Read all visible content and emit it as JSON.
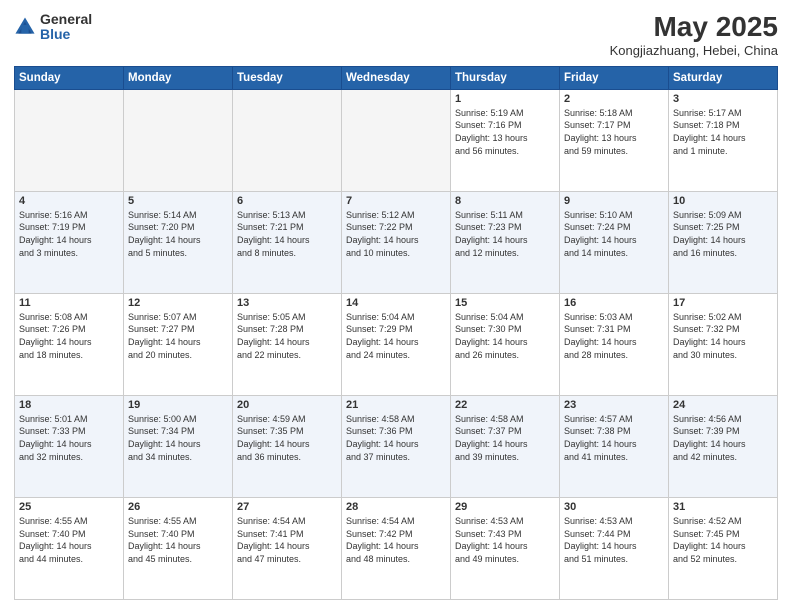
{
  "header": {
    "logo_line1": "General",
    "logo_line2": "Blue",
    "month_title": "May 2025",
    "location": "Kongjiazhuang, Hebei, China"
  },
  "weekdays": [
    "Sunday",
    "Monday",
    "Tuesday",
    "Wednesday",
    "Thursday",
    "Friday",
    "Saturday"
  ],
  "weeks": [
    [
      {
        "day": "",
        "info": ""
      },
      {
        "day": "",
        "info": ""
      },
      {
        "day": "",
        "info": ""
      },
      {
        "day": "",
        "info": ""
      },
      {
        "day": "1",
        "info": "Sunrise: 5:19 AM\nSunset: 7:16 PM\nDaylight: 13 hours\nand 56 minutes."
      },
      {
        "day": "2",
        "info": "Sunrise: 5:18 AM\nSunset: 7:17 PM\nDaylight: 13 hours\nand 59 minutes."
      },
      {
        "day": "3",
        "info": "Sunrise: 5:17 AM\nSunset: 7:18 PM\nDaylight: 14 hours\nand 1 minute."
      }
    ],
    [
      {
        "day": "4",
        "info": "Sunrise: 5:16 AM\nSunset: 7:19 PM\nDaylight: 14 hours\nand 3 minutes."
      },
      {
        "day": "5",
        "info": "Sunrise: 5:14 AM\nSunset: 7:20 PM\nDaylight: 14 hours\nand 5 minutes."
      },
      {
        "day": "6",
        "info": "Sunrise: 5:13 AM\nSunset: 7:21 PM\nDaylight: 14 hours\nand 8 minutes."
      },
      {
        "day": "7",
        "info": "Sunrise: 5:12 AM\nSunset: 7:22 PM\nDaylight: 14 hours\nand 10 minutes."
      },
      {
        "day": "8",
        "info": "Sunrise: 5:11 AM\nSunset: 7:23 PM\nDaylight: 14 hours\nand 12 minutes."
      },
      {
        "day": "9",
        "info": "Sunrise: 5:10 AM\nSunset: 7:24 PM\nDaylight: 14 hours\nand 14 minutes."
      },
      {
        "day": "10",
        "info": "Sunrise: 5:09 AM\nSunset: 7:25 PM\nDaylight: 14 hours\nand 16 minutes."
      }
    ],
    [
      {
        "day": "11",
        "info": "Sunrise: 5:08 AM\nSunset: 7:26 PM\nDaylight: 14 hours\nand 18 minutes."
      },
      {
        "day": "12",
        "info": "Sunrise: 5:07 AM\nSunset: 7:27 PM\nDaylight: 14 hours\nand 20 minutes."
      },
      {
        "day": "13",
        "info": "Sunrise: 5:05 AM\nSunset: 7:28 PM\nDaylight: 14 hours\nand 22 minutes."
      },
      {
        "day": "14",
        "info": "Sunrise: 5:04 AM\nSunset: 7:29 PM\nDaylight: 14 hours\nand 24 minutes."
      },
      {
        "day": "15",
        "info": "Sunrise: 5:04 AM\nSunset: 7:30 PM\nDaylight: 14 hours\nand 26 minutes."
      },
      {
        "day": "16",
        "info": "Sunrise: 5:03 AM\nSunset: 7:31 PM\nDaylight: 14 hours\nand 28 minutes."
      },
      {
        "day": "17",
        "info": "Sunrise: 5:02 AM\nSunset: 7:32 PM\nDaylight: 14 hours\nand 30 minutes."
      }
    ],
    [
      {
        "day": "18",
        "info": "Sunrise: 5:01 AM\nSunset: 7:33 PM\nDaylight: 14 hours\nand 32 minutes."
      },
      {
        "day": "19",
        "info": "Sunrise: 5:00 AM\nSunset: 7:34 PM\nDaylight: 14 hours\nand 34 minutes."
      },
      {
        "day": "20",
        "info": "Sunrise: 4:59 AM\nSunset: 7:35 PM\nDaylight: 14 hours\nand 36 minutes."
      },
      {
        "day": "21",
        "info": "Sunrise: 4:58 AM\nSunset: 7:36 PM\nDaylight: 14 hours\nand 37 minutes."
      },
      {
        "day": "22",
        "info": "Sunrise: 4:58 AM\nSunset: 7:37 PM\nDaylight: 14 hours\nand 39 minutes."
      },
      {
        "day": "23",
        "info": "Sunrise: 4:57 AM\nSunset: 7:38 PM\nDaylight: 14 hours\nand 41 minutes."
      },
      {
        "day": "24",
        "info": "Sunrise: 4:56 AM\nSunset: 7:39 PM\nDaylight: 14 hours\nand 42 minutes."
      }
    ],
    [
      {
        "day": "25",
        "info": "Sunrise: 4:55 AM\nSunset: 7:40 PM\nDaylight: 14 hours\nand 44 minutes."
      },
      {
        "day": "26",
        "info": "Sunrise: 4:55 AM\nSunset: 7:40 PM\nDaylight: 14 hours\nand 45 minutes."
      },
      {
        "day": "27",
        "info": "Sunrise: 4:54 AM\nSunset: 7:41 PM\nDaylight: 14 hours\nand 47 minutes."
      },
      {
        "day": "28",
        "info": "Sunrise: 4:54 AM\nSunset: 7:42 PM\nDaylight: 14 hours\nand 48 minutes."
      },
      {
        "day": "29",
        "info": "Sunrise: 4:53 AM\nSunset: 7:43 PM\nDaylight: 14 hours\nand 49 minutes."
      },
      {
        "day": "30",
        "info": "Sunrise: 4:53 AM\nSunset: 7:44 PM\nDaylight: 14 hours\nand 51 minutes."
      },
      {
        "day": "31",
        "info": "Sunrise: 4:52 AM\nSunset: 7:45 PM\nDaylight: 14 hours\nand 52 minutes."
      }
    ]
  ]
}
